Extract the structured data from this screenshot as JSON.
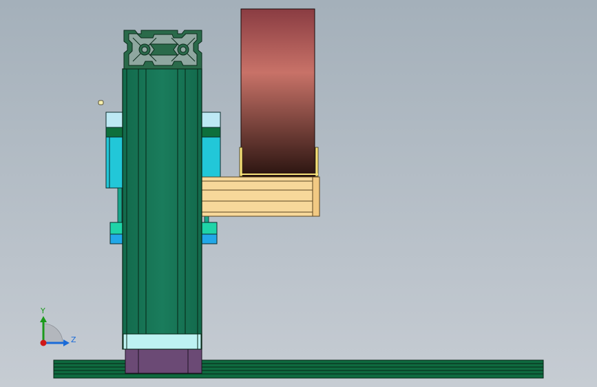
{
  "viewport": {
    "background_top": "#a4b0ba",
    "background_bottom": "#c6ccd3"
  },
  "model": {
    "profile_color": "#1a7a5a",
    "profile_outline": "#0a2a1a",
    "roller_gradient": [
      "#8a3c42",
      "#c87268",
      "#2a1410"
    ],
    "bracket_color": "#f7d89a",
    "slider_color": "#22c7d8",
    "slider_cap_color": "#bde9f4",
    "base_block_color": "#6b4a75",
    "rail_color": "#0f6a3f"
  },
  "triad": {
    "y_label": "Y",
    "z_label": "Z",
    "y_color": "#1b9a1b",
    "z_color": "#1a6bd8",
    "origin_color": "#d01818"
  }
}
